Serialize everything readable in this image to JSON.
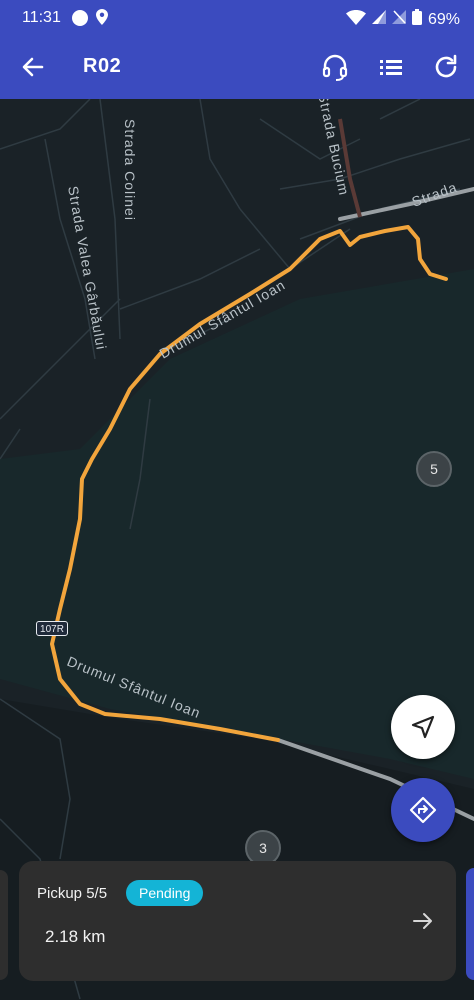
{
  "status_bar": {
    "time": "11:31",
    "battery": "69%"
  },
  "app_bar": {
    "title": "R02",
    "icons": [
      "back-arrow-icon",
      "headset-icon",
      "list-icon",
      "refresh-icon"
    ]
  },
  "map": {
    "street_labels": {
      "colinei": "Strada Colinei",
      "valea_garbaului": "Strada Valea Gârbăului",
      "bucium": "Strada Bucium",
      "strada_right": "Strada",
      "sfantul_ioan_upper": "Drumul Sfântul Ioan",
      "sfantul_ioan_lower": "Drumul Sfântul Ioan"
    },
    "road_shield": "107R",
    "stop_badges": {
      "stop_5": "5",
      "stop_3": "3"
    },
    "route_color": "#f2a53c",
    "road_color": "#9aa0a4"
  },
  "buttons": {
    "my_location": "navigation-arrow-icon",
    "directions": "directions-icon"
  },
  "pickup_card": {
    "title": "Pickup 5/5",
    "status": "Pending",
    "status_color": "#14b4d6",
    "distance": "2.18 km"
  },
  "colors": {
    "primary": "#3b4bbf",
    "map_background": "#1a2227",
    "water": "#18272b"
  }
}
